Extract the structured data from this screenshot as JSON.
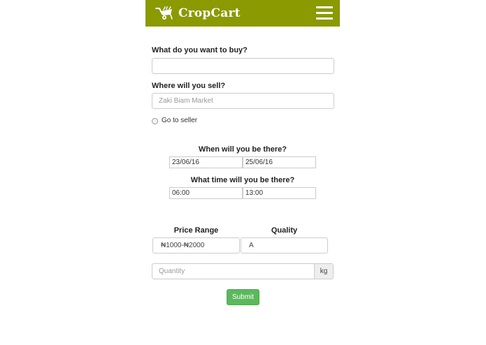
{
  "navbar": {
    "brand_name": "CropCart",
    "logo_icon": "wheelbarrow-icon",
    "menu_icon": "hamburger-menu-icon",
    "background_color": "#8a9a00"
  },
  "form": {
    "buy_label": "What do you want to buy?",
    "buy_value": "",
    "sell_label": "Where will you sell?",
    "sell_placeholder": "Zaki Biam Market",
    "go_to_seller_label": "Go to seller",
    "when_label": "When will you be there?",
    "date_from": "23/06/16",
    "date_to": "25/06/16",
    "time_label": "What time will you be there?",
    "time_from": "06:00",
    "time_to": "13:00",
    "price_range_label": "Price Range",
    "price_range_value": "₦1000-₦2000",
    "quality_label": "Quality",
    "quality_value": "A",
    "quantity_placeholder": "Quantity",
    "quantity_unit": "kg",
    "submit_label": "Submit",
    "submit_color": "#5cb85c"
  }
}
